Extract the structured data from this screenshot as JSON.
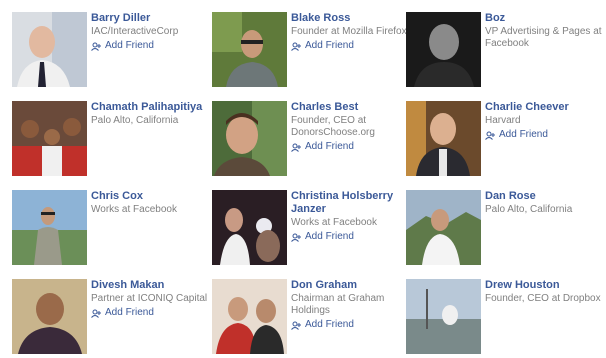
{
  "people": [
    [
      {
        "name": "",
        "subtitle": "",
        "add_label": ""
      },
      {
        "name": "",
        "subtitle": "",
        "add_label": ""
      },
      {
        "name": "",
        "subtitle": "",
        "add_label": ""
      }
    ],
    [
      {
        "name": "Barry Diller",
        "subtitle": "IAC/InteractiveCorp",
        "add_label": "Add Friend"
      },
      {
        "name": "Blake Ross",
        "subtitle": "Founder at Mozilla Firefox",
        "add_label": "Add Friend"
      },
      {
        "name": "Boz",
        "subtitle": "VP Advertising & Pages at Facebook",
        "add_label": ""
      }
    ],
    [
      {
        "name": "Chamath Palihapitiya",
        "subtitle": "Palo Alto, California",
        "add_label": ""
      },
      {
        "name": "Charles Best",
        "subtitle": "Founder, CEO at DonorsChoose.org",
        "add_label": "Add Friend"
      },
      {
        "name": "Charlie Cheever",
        "subtitle": "Harvard",
        "add_label": "Add Friend"
      }
    ],
    [
      {
        "name": "Chris Cox",
        "subtitle": "Works at Facebook",
        "add_label": ""
      },
      {
        "name": "Christina Holsberry Janzer",
        "subtitle": "Works at Facebook",
        "add_label": "Add Friend"
      },
      {
        "name": "Dan Rose",
        "subtitle": "Palo Alto, California",
        "add_label": ""
      }
    ],
    [
      {
        "name": "Divesh Makan",
        "subtitle": "Partner at ICONIQ Capital",
        "add_label": "Add Friend"
      },
      {
        "name": "Don Graham",
        "subtitle": "Chairman at Graham Holdings",
        "add_label": "Add Friend"
      },
      {
        "name": "Drew Houston",
        "subtitle": "Founder, CEO at Dropbox",
        "add_label": ""
      }
    ]
  ],
  "colors": {
    "link": "#3b5998",
    "subtitle": "#808080"
  },
  "icons": {
    "add_friend": "add-friend-icon"
  }
}
